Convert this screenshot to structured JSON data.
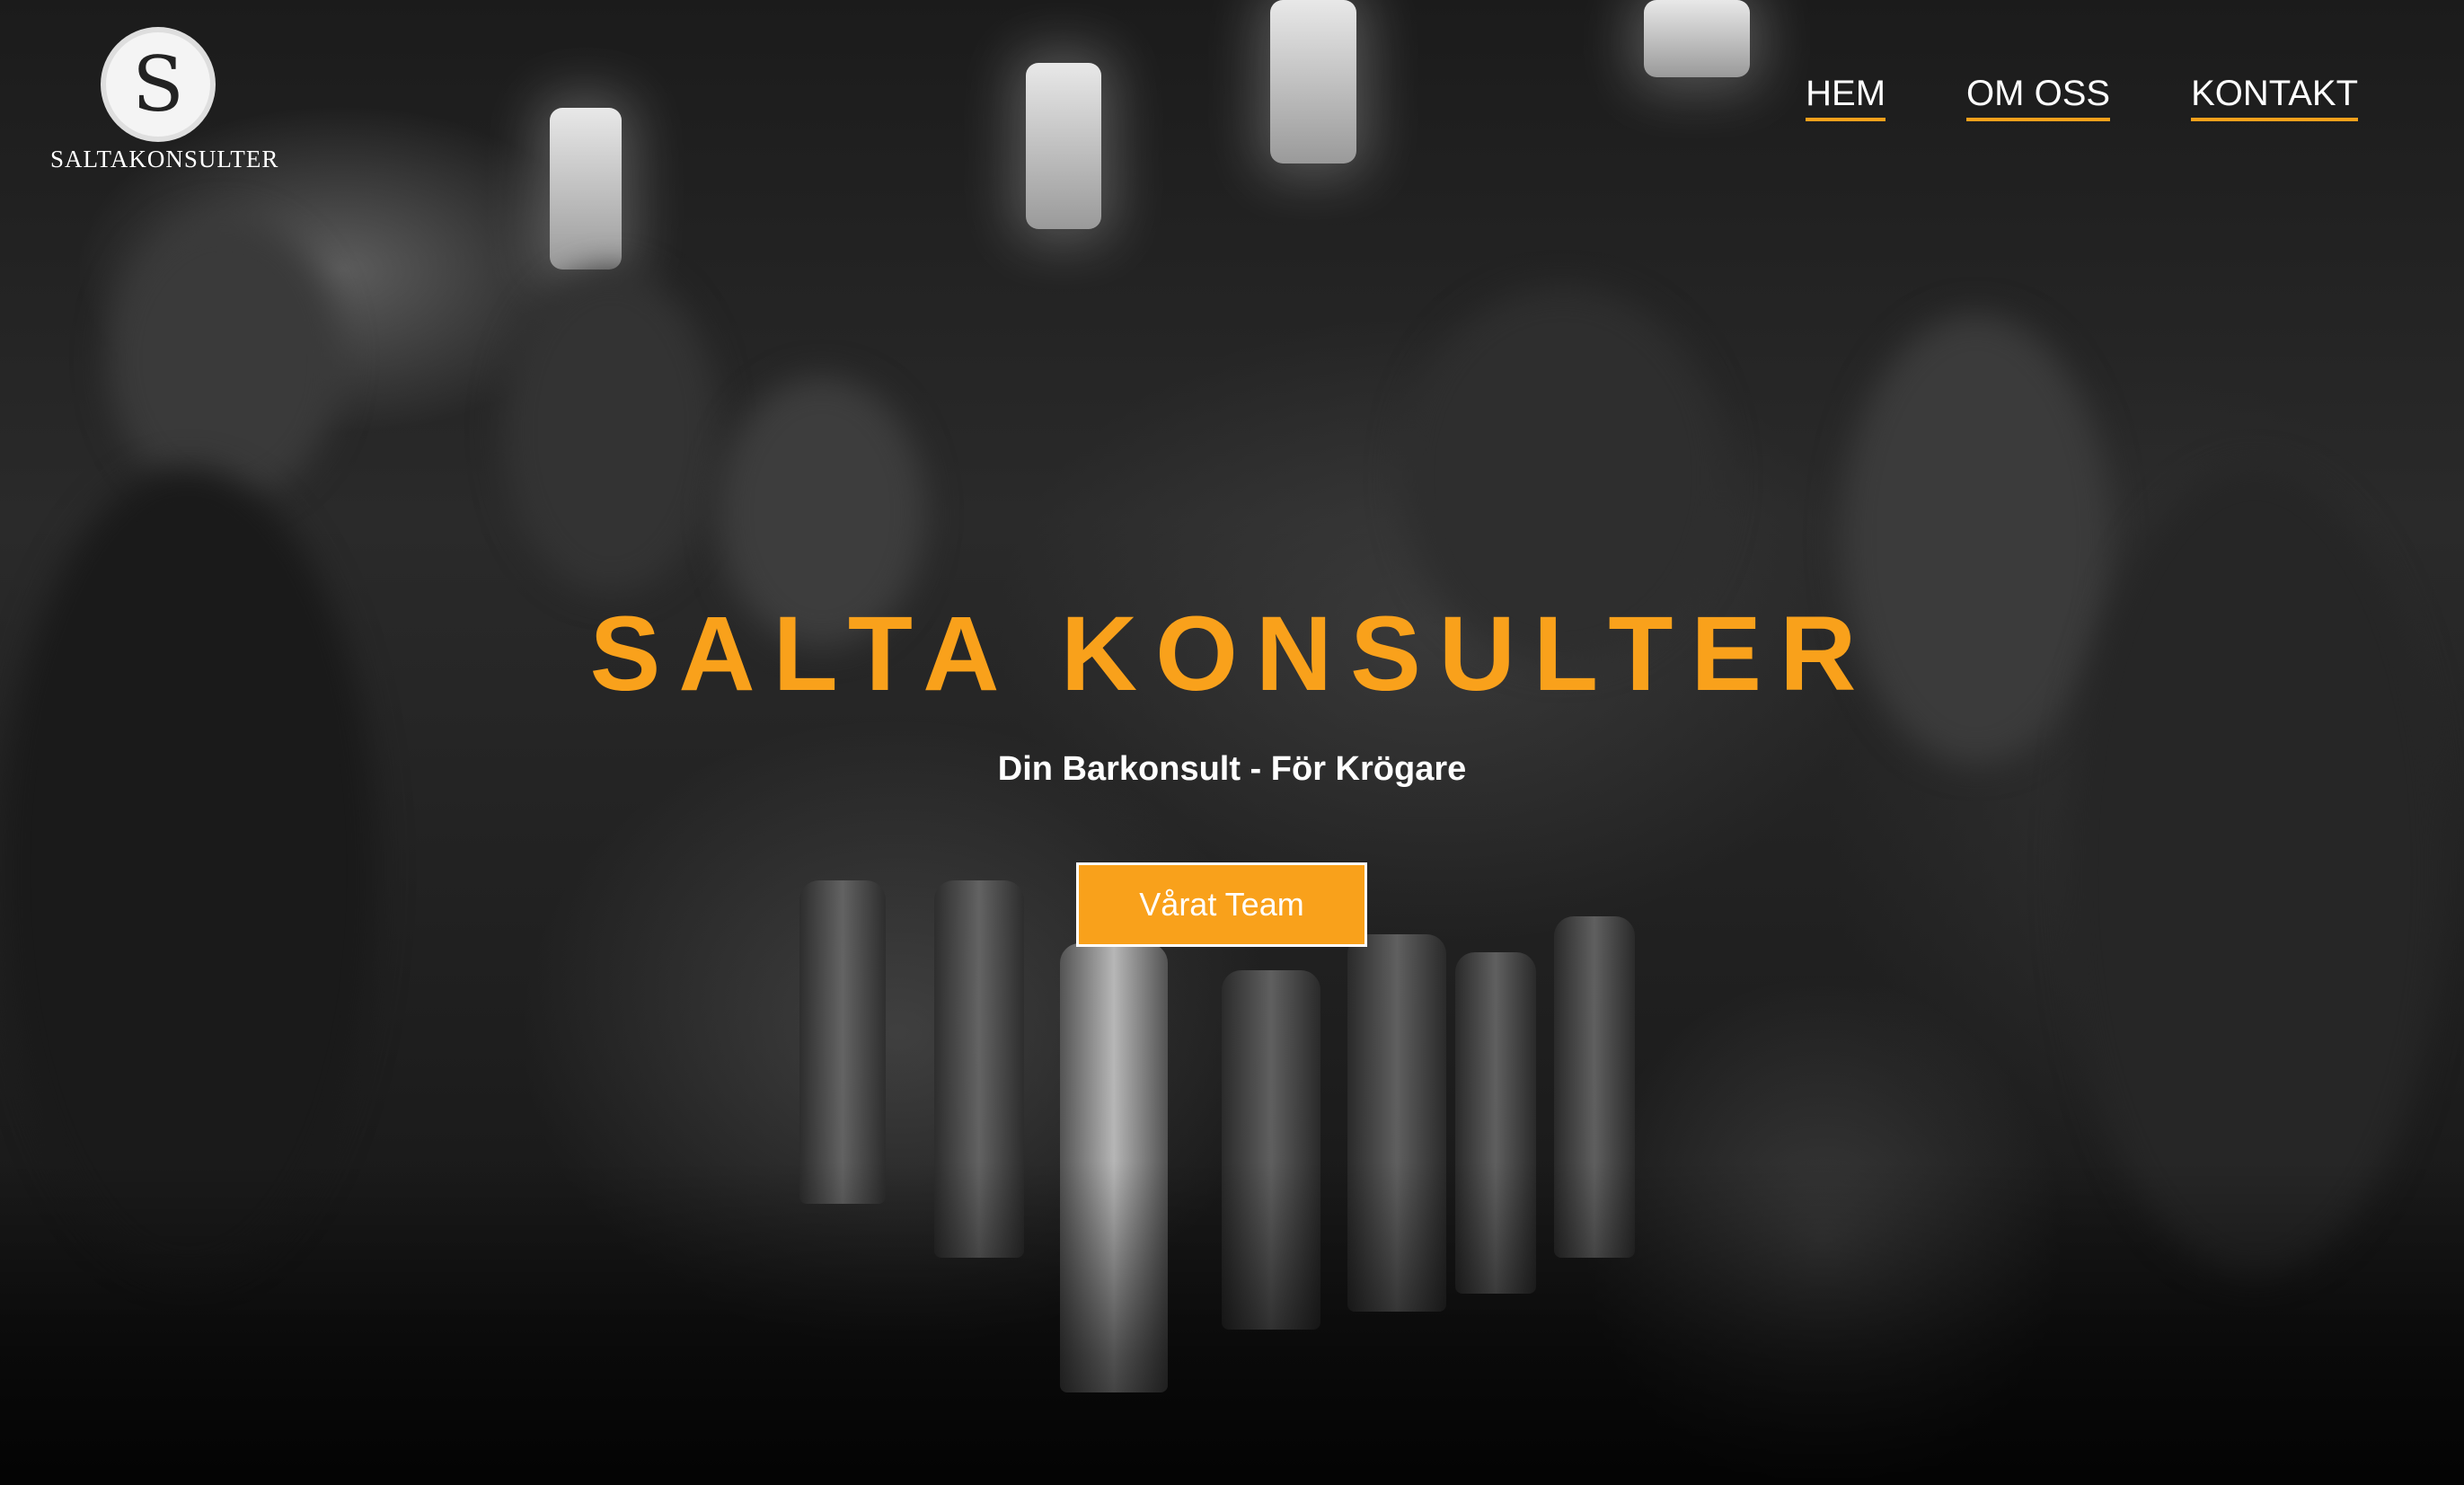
{
  "brand": {
    "logo_letter": "S",
    "logo_text": "SALTAKONSULTER"
  },
  "nav": {
    "items": [
      {
        "label": "HEM"
      },
      {
        "label": "OM OSS"
      },
      {
        "label": "KONTAKT"
      }
    ]
  },
  "hero": {
    "title": "SALTA KONSULTER",
    "subtitle": "Din Barkonsult - För Krögare",
    "cta_label": "Vårat Team",
    "background_image": "bar-scene-photo"
  },
  "colors": {
    "accent": "#f9a11b",
    "text": "#ffffff"
  }
}
